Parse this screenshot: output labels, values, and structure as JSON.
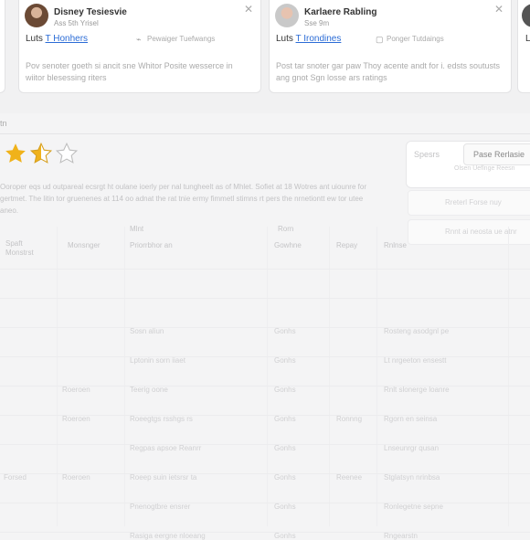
{
  "cards": [
    {
      "author": "Disney Tesiesvie",
      "role": "Ass 5th Yrisel",
      "plan_prefix": "Luts",
      "plan_link": "T Honhers",
      "meta": "Pewaiger Tuefwangs",
      "body": "Pov senoter goeth si ancit sne Whitor Posite wesserce in wiitor blesessing riters"
    },
    {
      "author": "Karlaere Rabling",
      "role": "Sse 9m",
      "plan_prefix": "Luts",
      "plan_link": "T Irondines",
      "meta": "Ponger Tutdaings",
      "body": "Post tar snoter gar paw Thoy acente andt for i. edsts soutusts ang gnot Sgn losse ars ratings"
    }
  ],
  "edge_card_letter": "L",
  "rating": {
    "value": 2.5,
    "max": 5,
    "star_color": "#f0b21a"
  },
  "description": "Ooroper eqs ud outpareal ecsrgt ht oulane ioerly per nal tungheelt as of Mhlet. Sofiet at 18 Wotres ant uiounre for gertmet. The litin tor gruenenes at 114 oo adnat the rat tnie ermy fimmetl stimns rt pers the nrnetiontt ew tor utee aneo.",
  "side_panel": {
    "tab_a": "Spesrs",
    "tab_b": "Pase Rerlasie",
    "sub": "Olsen Ueflnge Reesn",
    "field_1": "Rreterl Forse nuy",
    "field_2": "Rnnt ai neosta ue atnr"
  },
  "table": {
    "headers": [
      "Spaft Monstrst",
      "Monsnger",
      "Priorrbhor an",
      "Gowhne",
      "Repay",
      "Rnlnse"
    ],
    "col_header_top": [
      "Mlnt",
      "Rorn"
    ],
    "rows": [
      [
        "",
        "",
        "",
        "",
        "",
        ""
      ],
      [
        "",
        "",
        "Sosn aliun",
        "Gonhs",
        "",
        "Rosteng asodgnl pe"
      ],
      [
        "",
        "",
        "Lptonin sorn iiaet",
        "Gonhs",
        "",
        "Lt nrgeeton ensestt"
      ],
      [
        "",
        "Roeroen",
        "Teerig oone",
        "Gonhs",
        "",
        "Rnlt slonerge loanre"
      ],
      [
        "",
        "Roeroen",
        "Roeegtgs rsshgs rs",
        "Gonhs",
        "Ronnng",
        "Rgorn en seinsa"
      ],
      [
        "",
        "",
        "Regpas apsoe Reanrr",
        "Gonhs",
        "",
        "Lnseunrgr qusan"
      ],
      [
        "Forsed",
        "Roeroen",
        "Roeep suin ietsrsr ta",
        "Gonhs",
        "Reenee",
        "Stglatsyn nrinbsa"
      ],
      [
        "",
        "",
        "Pnenogtbre ensrer",
        "Gonhs",
        "",
        "Ronlegetne sepne"
      ],
      [
        "",
        "",
        "Rasiga eergne nloeang",
        "Gonhs",
        "",
        "Rngearstn"
      ]
    ]
  },
  "tab_marker": "tn"
}
